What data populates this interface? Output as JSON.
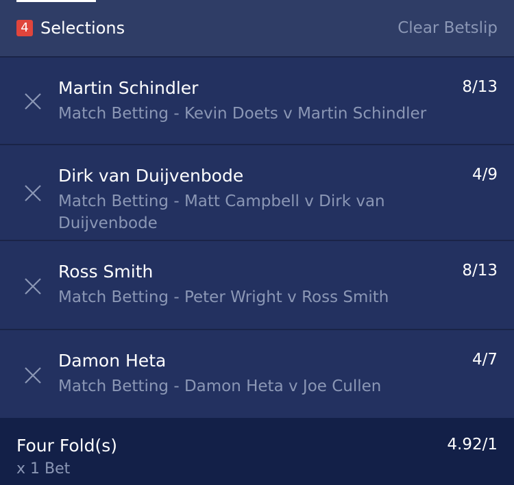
{
  "header": {
    "count": "4",
    "title": "Selections",
    "clear_label": "Clear Betslip"
  },
  "selections": [
    {
      "name": "Martin Schindler",
      "market": "Match Betting - Kevin Doets v Martin Schindler",
      "odds": "8/13"
    },
    {
      "name": "Dirk van Duijvenbode",
      "market": "Match Betting - Matt Campbell v Dirk van Duijvenbode",
      "odds": "4/9"
    },
    {
      "name": "Ross Smith",
      "market": "Match Betting - Peter Wright v Ross Smith",
      "odds": "8/13"
    },
    {
      "name": "Damon Heta",
      "market": "Match Betting - Damon Heta v Joe Cullen",
      "odds": "4/7"
    }
  ],
  "footer": {
    "bet_type": "Four Fold(s)",
    "bet_count": "x 1 Bet",
    "odds": "4.92/1"
  },
  "colors": {
    "background": "#233160",
    "header": "#2f3d66",
    "footer": "#132048",
    "badge": "#e0453c",
    "muted_text": "#8b97b5"
  }
}
